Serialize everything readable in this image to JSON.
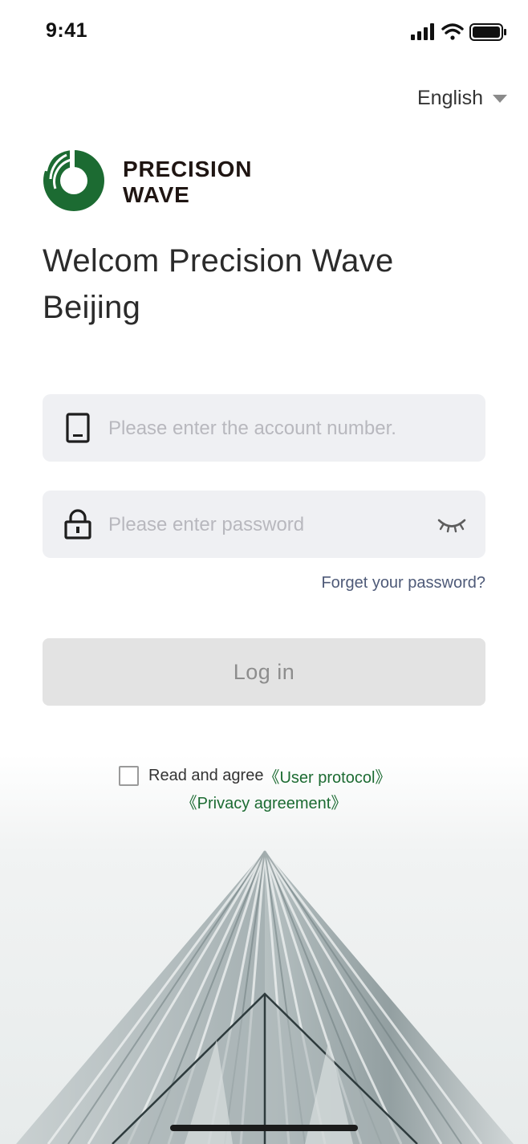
{
  "status_bar": {
    "time": "9:41"
  },
  "language": {
    "label": "English"
  },
  "brand": {
    "line1": "PRECISION",
    "line2": "WAVE"
  },
  "welcome": {
    "title": "Welcom Precision Wave Beijing"
  },
  "account": {
    "placeholder": "Please enter the account number.",
    "value": ""
  },
  "password": {
    "placeholder": "Please enter password",
    "value": ""
  },
  "forgot": {
    "label": "Forget your password?"
  },
  "login": {
    "label": "Log in"
  },
  "agreement": {
    "prefix": "Read and agree ",
    "user_protocol": "《User protocol》",
    "privacy": "《Privacy agreement》",
    "checked": false
  },
  "colors": {
    "brand_green": "#1c6b32",
    "field_bg": "#eff0f3",
    "button_disabled": "#e3e3e3"
  },
  "icons": [
    "signal-icon",
    "wifi-icon",
    "battery-icon",
    "caret-down-icon",
    "logo-icon",
    "phone-icon",
    "lock-icon",
    "eye-closed-icon"
  ]
}
